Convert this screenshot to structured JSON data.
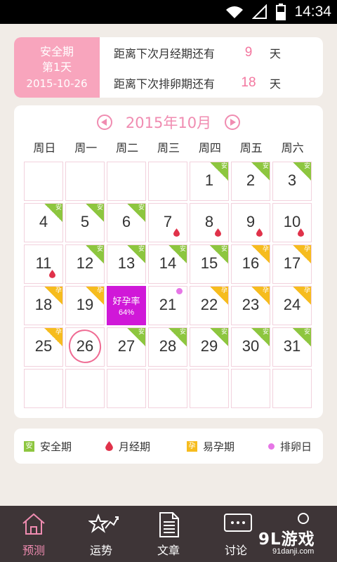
{
  "status_bar": {
    "time": "14:34",
    "icons": [
      "wifi-icon",
      "signal-icon",
      "battery-icon"
    ]
  },
  "info_card": {
    "phase_name": "安全期",
    "phase_day": "第1天",
    "date": "2015-10-26",
    "lines": [
      {
        "label": "距离下次月经期还有",
        "value": "9",
        "unit": "天"
      },
      {
        "label": "距离下次排卵期还有",
        "value": "18",
        "unit": "天"
      }
    ]
  },
  "calendar": {
    "month_title": "2015年10月",
    "weekdays": [
      "周日",
      "周一",
      "周二",
      "周三",
      "周四",
      "周五",
      "周六"
    ],
    "first_weekday": 4,
    "rows": 6,
    "today": 26,
    "highlight": {
      "day": 20,
      "title": "好孕率",
      "percent": "64%"
    },
    "days": [
      {
        "d": 1,
        "tag": "safe"
      },
      {
        "d": 2,
        "tag": "safe"
      },
      {
        "d": 3,
        "tag": "safe"
      },
      {
        "d": 4,
        "tag": "safe"
      },
      {
        "d": 5,
        "tag": "safe"
      },
      {
        "d": 6,
        "tag": "safe"
      },
      {
        "d": 7,
        "tag": "period"
      },
      {
        "d": 8,
        "tag": "period"
      },
      {
        "d": 9,
        "tag": "period"
      },
      {
        "d": 10,
        "tag": "period"
      },
      {
        "d": 11,
        "tag": "period"
      },
      {
        "d": 12,
        "tag": "safe"
      },
      {
        "d": 13,
        "tag": "safe"
      },
      {
        "d": 14,
        "tag": "safe"
      },
      {
        "d": 15,
        "tag": "safe"
      },
      {
        "d": 16,
        "tag": "fertile"
      },
      {
        "d": 17,
        "tag": "fertile"
      },
      {
        "d": 18,
        "tag": "fertile"
      },
      {
        "d": 19,
        "tag": "fertile"
      },
      {
        "d": 20,
        "tag": "highlight"
      },
      {
        "d": 21,
        "tag": "ovulation"
      },
      {
        "d": 22,
        "tag": "fertile"
      },
      {
        "d": 23,
        "tag": "fertile"
      },
      {
        "d": 24,
        "tag": "fertile"
      },
      {
        "d": 25,
        "tag": "fertile"
      },
      {
        "d": 26,
        "tag": "none"
      },
      {
        "d": 27,
        "tag": "safe"
      },
      {
        "d": 28,
        "tag": "safe"
      },
      {
        "d": 29,
        "tag": "safe"
      },
      {
        "d": 30,
        "tag": "safe"
      },
      {
        "d": 31,
        "tag": "safe"
      }
    ],
    "badge_safe": "安",
    "badge_fertile": "孕"
  },
  "legend": [
    {
      "type": "safe",
      "badge": "安",
      "label": "安全期"
    },
    {
      "type": "period",
      "label": "月经期"
    },
    {
      "type": "fertile",
      "badge": "孕",
      "label": "易孕期"
    },
    {
      "type": "ovulation",
      "label": "排卵日"
    }
  ],
  "bottom_nav": [
    {
      "label": "预测",
      "icon": "home-icon",
      "active": true
    },
    {
      "label": "运势",
      "icon": "star-trend-icon",
      "active": false
    },
    {
      "label": "文章",
      "icon": "document-icon",
      "active": false
    },
    {
      "label": "讨论",
      "icon": "chat-icon",
      "active": false
    },
    {
      "label": "",
      "icon": "profile-icon",
      "active": false
    }
  ],
  "watermark": {
    "main": "9L游戏",
    "sub": "91danji.com"
  },
  "colors": {
    "pink": "#f8a5bd",
    "accent": "#f08cb1",
    "safe": "#8dc63f",
    "fertile": "#f6bc1e",
    "period": "#e0324a",
    "ovulation": "#e676e6",
    "highlight": "#d018d8"
  }
}
